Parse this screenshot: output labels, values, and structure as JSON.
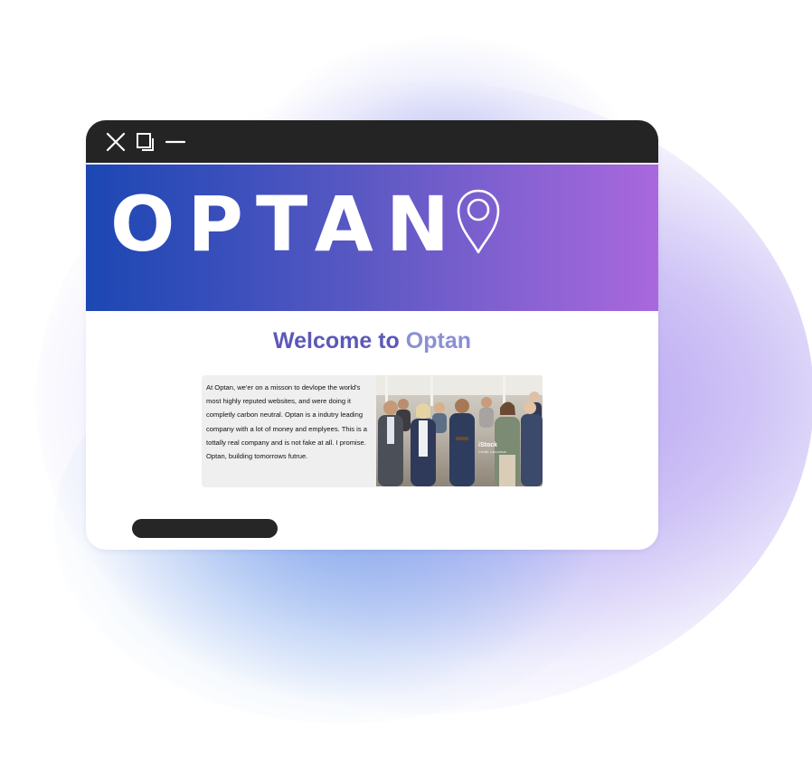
{
  "window": {
    "controls": {
      "close_icon": "close-icon",
      "restore_icon": "restore-icon",
      "minimize_icon": "minimize-icon"
    }
  },
  "banner": {
    "logo_text": "OPTAN",
    "logo_icon": "location-pin-icon"
  },
  "main": {
    "heading_prefix": "Welcome to ",
    "heading_brand": "Optan",
    "intro_text": "At Optan, we'er on a misson to devlope the world's most highly reputed websites, and were doing it completly carbon neutral. Optan is a indutry leading company with a lot of money and emplyees. This is a tottally real company and is not fake at all. I promise. Optan, building tomorrows futrue.",
    "photo": {
      "watermark": "iStock",
      "watermark_sub": "Credit: Laconicus"
    }
  },
  "colors": {
    "titlebar": "#242424",
    "banner_start": "#1c47b3",
    "banner_end": "#a968dd",
    "heading": "#5b58b8",
    "heading_brand": "#8b8fd4",
    "intro_bg": "#efefef",
    "bottom_bar": "#262626"
  }
}
